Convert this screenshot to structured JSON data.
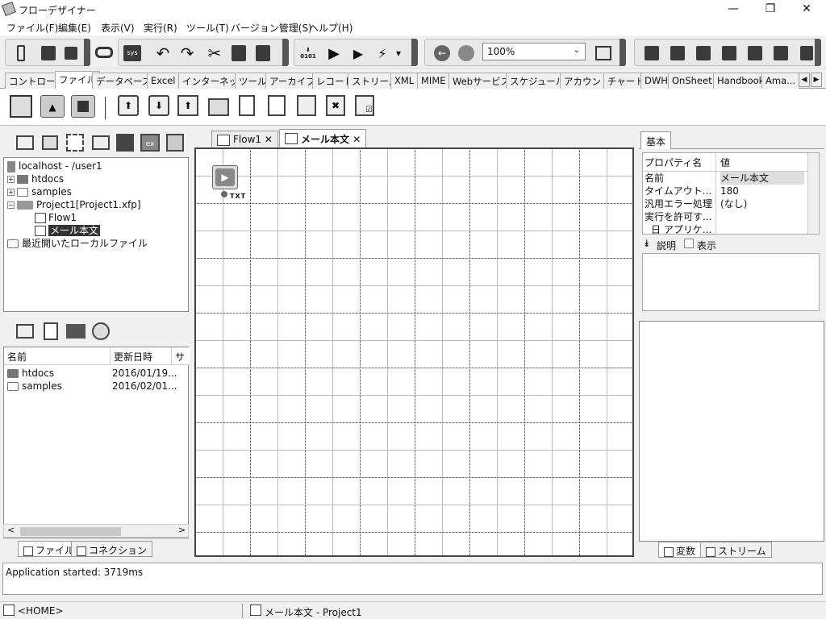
{
  "window": {
    "title": "フローデザイナー",
    "minimize": "—",
    "maximize": "❐",
    "close": "✕"
  },
  "menu": [
    {
      "label": "ファイル(F)"
    },
    {
      "label": "編集(E)"
    },
    {
      "label": "表示(V)"
    },
    {
      "label": "実行(R)"
    },
    {
      "label": "ツール(T)"
    },
    {
      "label": "バージョン管理(S)"
    },
    {
      "label": "ヘルプ(H)"
    }
  ],
  "toolbar": {
    "zoom": "100%",
    "zoom_arrow": "⌄",
    "dropdown_arrow": "▾"
  },
  "component_tabs": [
    "コントロール",
    "ファイル",
    "データベース",
    "Excel",
    "インターネット",
    "ツール",
    "アーカイブ",
    "レコード",
    "ストリーム",
    "XML",
    "MIME",
    "Webサービス",
    "スケジュール",
    "アカウント",
    "チャート",
    "DWH",
    "OnSheet",
    "Handbook",
    "Ama..."
  ],
  "component_tabs_active": "ファイル",
  "tab_scroll": {
    "left": "◀",
    "right": "▶"
  },
  "tree": {
    "items": [
      {
        "label": "localhost - /user1"
      },
      {
        "label": "htdocs"
      },
      {
        "label": "samples"
      },
      {
        "label": "Project1[Project1.xfp]"
      },
      {
        "label": "Flow1"
      },
      {
        "label": "メール本文"
      },
      {
        "label": "最近開いたローカルファイル"
      }
    ],
    "expand_plus": "+",
    "expand_minus": "−"
  },
  "file_list": {
    "headers": [
      "名前",
      "更新日時",
      "サイ"
    ],
    "rows": [
      {
        "name": "htdocs",
        "modified": "2016/01/19..."
      },
      {
        "name": "samples",
        "modified": "2016/02/01..."
      }
    ],
    "scroll_left": "<",
    "scroll_right": ">"
  },
  "left_bottom_tabs": [
    "ファイル",
    "コネクション"
  ],
  "editor_tabs": [
    {
      "label": "Flow1"
    },
    {
      "label": "メール本文"
    }
  ],
  "close_glyph": "✕",
  "canvas": {
    "node_label": "TXT"
  },
  "properties": {
    "tab": "基本",
    "headers": [
      "プロパティ名",
      "値"
    ],
    "rows": [
      {
        "name": "名前",
        "value": "メール本文"
      },
      {
        "name": "タイムアウト...",
        "value": "180"
      },
      {
        "name": "汎用エラー処理",
        "value": "(なし)"
      },
      {
        "name": "実行を許可す...",
        "value": ""
      },
      {
        "name": "日 アプリケ...",
        "value": ""
      }
    ],
    "desc_label": "説明",
    "show_label": "表示"
  },
  "right_bottom_tabs": [
    "変数",
    "ストリーム"
  ],
  "output": {
    "text": "Application started: 3719ms"
  },
  "statusbar": {
    "home": "<HOME>",
    "current": "メール本文 - Project1"
  }
}
